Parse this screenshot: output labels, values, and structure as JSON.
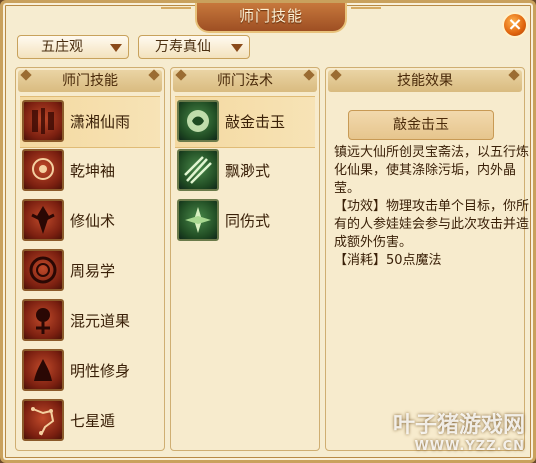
{
  "window": {
    "title": "师门技能",
    "close": "×"
  },
  "filters": {
    "school": "五庄观",
    "master": "万寿真仙"
  },
  "panels": {
    "skills_header": "师门技能",
    "spells_header": "师门法术",
    "effect_header": "技能效果"
  },
  "skills": [
    {
      "name": "潇湘仙雨",
      "icon": "rain-glyph-icon"
    },
    {
      "name": "乾坤袖",
      "icon": "sleeve-icon"
    },
    {
      "name": "修仙术",
      "icon": "immortal-art-icon"
    },
    {
      "name": "周易学",
      "icon": "trigram-icon"
    },
    {
      "name": "混元道果",
      "icon": "dao-fruit-icon"
    },
    {
      "name": "明性修身",
      "icon": "cultivation-icon"
    },
    {
      "name": "七星遁",
      "icon": "seven-stars-icon"
    }
  ],
  "spells": [
    {
      "name": "敲金击玉",
      "icon": "jade-strike-icon"
    },
    {
      "name": "飘渺式",
      "icon": "swords-icon"
    },
    {
      "name": "同伤式",
      "icon": "shared-wound-icon"
    }
  ],
  "effect": {
    "name": "敲金击玉",
    "lines": [
      "镇远大仙所创灵宝斋法，以五行炼化仙果，使其涤除污垢，内外晶莹。",
      "【功效】物理攻击单个目标，你所有的人参娃娃会参与此次攻击并造成额外伤害。",
      "【消耗】50点魔法"
    ]
  },
  "watermark": {
    "brand": "叶子猪游戏网",
    "url": "WWW.YZZ.CN"
  },
  "colors": {
    "frame": "#c9a15d",
    "panel": "#f7ebcd",
    "selected": "#f4d9a0",
    "accent": "#e0640d"
  }
}
